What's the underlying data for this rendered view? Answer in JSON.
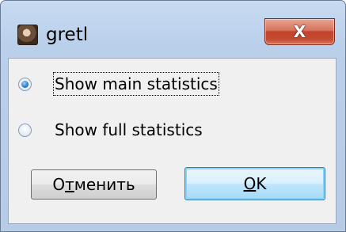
{
  "window": {
    "title": "gretl",
    "icon": "gretl-app-icon",
    "close_glyph": "X"
  },
  "options": {
    "items": [
      {
        "label": "Show main statistics",
        "checked": true
      },
      {
        "label": "Show full statistics",
        "checked": false
      }
    ]
  },
  "buttons": {
    "cancel_label": "Отменить",
    "cancel_mnemonic": "т",
    "ok_label": "OK",
    "ok_mnemonic": "O"
  }
}
